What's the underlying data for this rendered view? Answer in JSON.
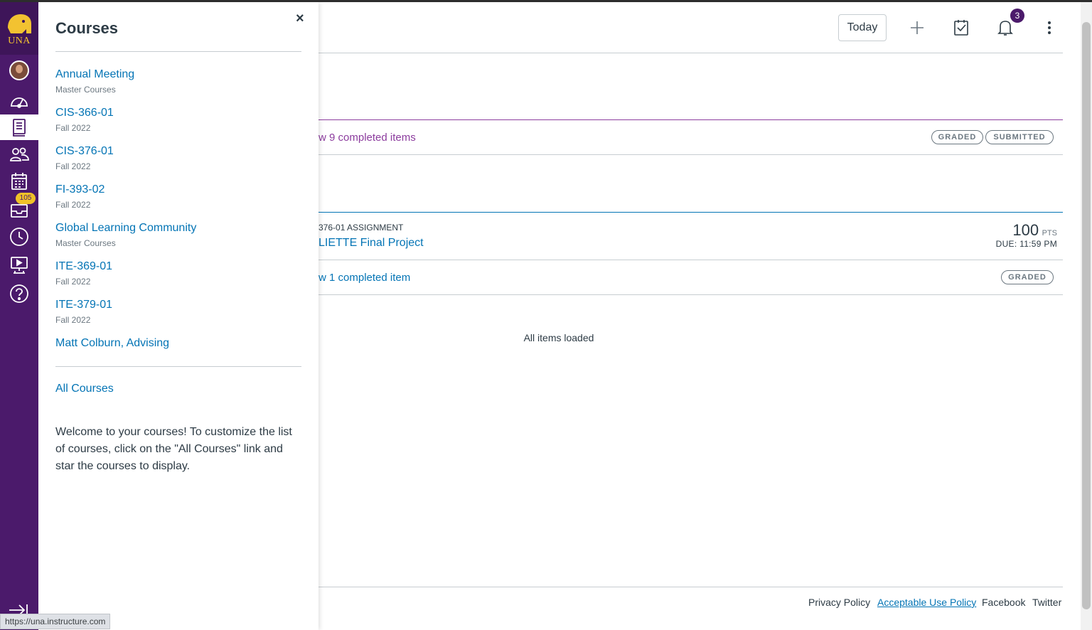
{
  "global_nav": {
    "logo_text": "UNA",
    "badges": {
      "inbox_count": "105"
    }
  },
  "tray": {
    "title": "Courses",
    "close_label": "×",
    "courses": [
      {
        "name": "Annual Meeting",
        "term": "Master Courses"
      },
      {
        "name": "CIS-366-01",
        "term": "Fall 2022"
      },
      {
        "name": "CIS-376-01",
        "term": "Fall 2022"
      },
      {
        "name": "FI-393-02",
        "term": "Fall 2022"
      },
      {
        "name": "Global Learning Community",
        "term": "Master Courses"
      },
      {
        "name": "ITE-369-01",
        "term": "Fall 2022"
      },
      {
        "name": "ITE-379-01",
        "term": "Fall 2022"
      },
      {
        "name": "Matt Colburn, Advising",
        "term": ""
      }
    ],
    "all_courses_label": "All Courses",
    "welcome_text": "Welcome to your courses! To customize the list of courses, click on the \"All Courses\" link and star the courses to display."
  },
  "header": {
    "today_label": "Today",
    "notification_count": "3"
  },
  "planner": {
    "group1": {
      "completed_text": "w 9 completed items",
      "pills": [
        "GRADED",
        "SUBMITTED"
      ]
    },
    "group2": {
      "assignment_type": "376-01 ASSIGNMENT",
      "assignment_title": "LIETTE Final Project",
      "points": "100",
      "points_label": "PTS",
      "due": "DUE: 11:59 PM",
      "completed_text": "w 1 completed item",
      "pills": [
        "GRADED"
      ]
    },
    "all_loaded": "All items loaded"
  },
  "footer": {
    "links": [
      "Privacy Policy",
      "Acceptable Use Policy",
      "Facebook",
      "Twitter"
    ]
  },
  "status_bar": {
    "url": "https://una.instructure.com"
  },
  "colors": {
    "nav_bg": "#4b1a6b",
    "logo_gold": "#f2c231",
    "link_blue": "#0374b5",
    "accent_purple": "#8c3c9e"
  },
  "icons": {
    "nav": [
      "account-avatar",
      "dashboard-icon",
      "courses-icon",
      "groups-icon",
      "calendar-icon",
      "inbox-icon",
      "history-icon",
      "studio-icon",
      "help-icon"
    ],
    "header": [
      "plus-icon",
      "todo-checklist-icon",
      "bell-icon",
      "kebab-menu-icon"
    ]
  }
}
